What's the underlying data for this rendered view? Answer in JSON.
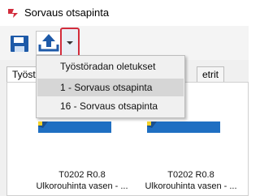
{
  "window": {
    "title": "Sorvaus otsapinta",
    "accent": "#d22c3c"
  },
  "toolbar": {
    "save_icon": "save-icon",
    "export_icon": "upload-icon",
    "dropdown_icon": "chevron-down-icon"
  },
  "tabs": [
    {
      "label": "Työst"
    },
    {
      "label": "etrit"
    }
  ],
  "dropdown_menu": {
    "items": [
      {
        "label": "Työstöradan oletukset",
        "selected": false
      },
      {
        "label": "1 - Sorvaus otsapinta",
        "selected": true
      },
      {
        "label": "16 - Sorvaus otsapinta",
        "selected": false
      }
    ]
  },
  "tools": [
    {
      "name": "T0202 R0.8",
      "description": "Ulkorouhinta vasen - ..."
    },
    {
      "name": "T0202 R0.8",
      "description": "Ulkorouhinta vasen - ..."
    }
  ]
}
